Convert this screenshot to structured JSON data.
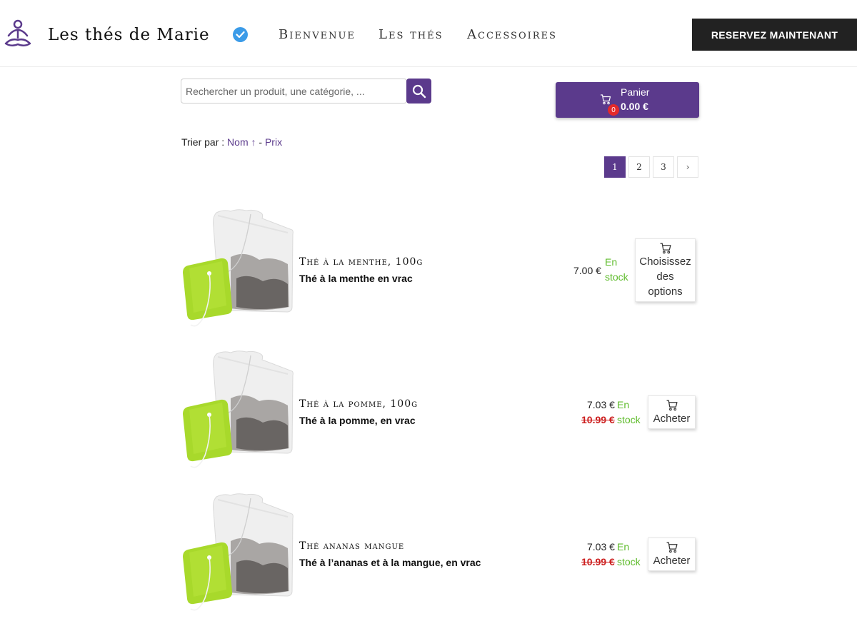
{
  "header": {
    "brand": "Les thés de Marie",
    "nav": [
      "Bienvenue",
      "Les thés",
      "Accessoires"
    ],
    "reserve_label": "RESERVEZ MAINTENANT",
    "accent_color": "#5b3a8c"
  },
  "search": {
    "placeholder": "Rechercher un produit, une catégorie, ..."
  },
  "cart": {
    "label": "Panier",
    "count": "0",
    "total": "0.00 €"
  },
  "sort": {
    "prefix": "Trier par :",
    "name": "Nom",
    "arrow": "↑",
    "separator": "-",
    "price": "Prix"
  },
  "pagination": {
    "pages": [
      "1",
      "2",
      "3"
    ],
    "next": "›",
    "current": "1"
  },
  "products": [
    {
      "title": "Thé à la menthe, 100g",
      "description": "Thé à la menthe en vrac",
      "price": "7.00 €",
      "old_price": "",
      "stock_line1": "En",
      "stock_line2": "stock",
      "button_lines": [
        "Choisissez",
        "des",
        "options"
      ]
    },
    {
      "title": "Thé à la pomme, 100g",
      "description": "Thé à la pomme, en vrac",
      "price": "7.03 €",
      "old_price": "10.99 €",
      "stock_line1": "En",
      "stock_line2": "stock",
      "button_lines": [
        "Acheter"
      ]
    },
    {
      "title": "Thé ananas mangue",
      "description": "Thé à l’ananas et à la mangue, en vrac",
      "price": "7.03 €",
      "old_price": "10.99 €",
      "stock_line1": "En",
      "stock_line2": "stock",
      "button_lines": [
        "Acheter"
      ]
    }
  ]
}
